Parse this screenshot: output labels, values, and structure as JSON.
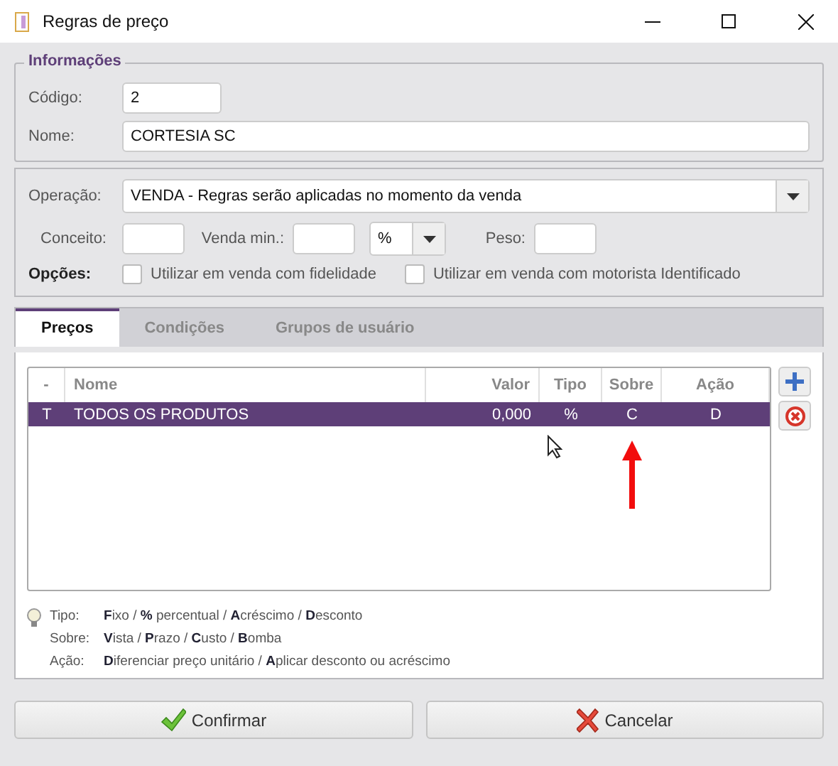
{
  "window": {
    "title": "Regras de preço"
  },
  "info": {
    "legend": "Informações",
    "codigo_label": "Código:",
    "codigo": "2",
    "nome_label": "Nome:",
    "nome": "CORTESIA SC"
  },
  "operacao": {
    "label": "Operação:",
    "value": "VENDA - Regras serão aplicadas no momento da venda"
  },
  "conceito": {
    "label": "Conceito:",
    "venda_min_label": "Venda min.:",
    "unit": "%",
    "peso_label": "Peso:"
  },
  "opcoes": {
    "label": "Opções:",
    "items": [
      {
        "label": "Utilizar em venda com fidelidade",
        "checked": false
      },
      {
        "label": "Utilizar em venda com motorista Identificado",
        "checked": false
      }
    ]
  },
  "tabs": [
    {
      "label": "Preços",
      "selected": true
    },
    {
      "label": "Condições",
      "selected": false
    },
    {
      "label": "Grupos de usuário",
      "selected": false
    }
  ],
  "table": {
    "columns": [
      "-",
      "Nome",
      "Valor",
      "Tipo",
      "Sobre",
      "Ação"
    ],
    "rows": [
      {
        "cells": [
          "T",
          "TODOS OS PRODUTOS",
          "0,000",
          "%",
          "C",
          "D"
        ],
        "selected": true
      }
    ]
  },
  "legend": [
    {
      "label": "Tipo:",
      "text": "**F**ixo / **%** percentual / **A**créscimo / **D**esconto"
    },
    {
      "label": "Sobre:",
      "text": "**V**ista / **P**razo / **C**usto / **B**omba"
    },
    {
      "label": "Ação:",
      "text": "**D**iferenciar preço unitário / **A**plicar desconto ou acréscimo"
    }
  ],
  "buttons": [
    {
      "label": "Confirmar",
      "kind": "confirm"
    },
    {
      "label": "Cancelar",
      "kind": "cancel"
    }
  ]
}
